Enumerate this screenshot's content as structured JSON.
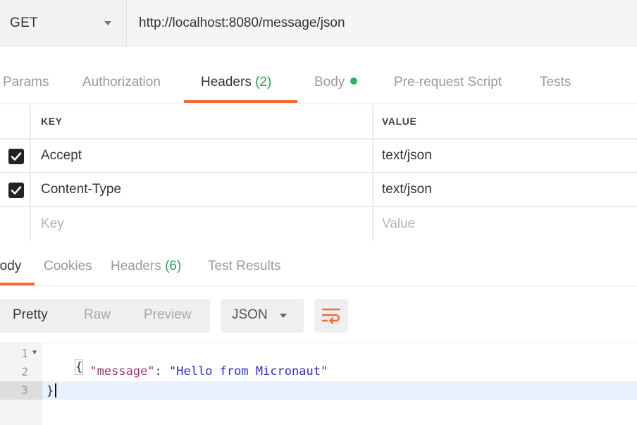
{
  "request": {
    "method": "GET",
    "url": "http://localhost:8080/message/json"
  },
  "request_tabs": {
    "params": "Params",
    "authorization": "Authorization",
    "headers": "Headers",
    "headers_count": "(2)",
    "body": "Body",
    "prerequest": "Pre-request Script",
    "tests": "Tests"
  },
  "headers_table": {
    "col_key": "KEY",
    "col_value": "VALUE",
    "rows": [
      {
        "checked": true,
        "key": "Accept",
        "value": "text/json"
      },
      {
        "checked": true,
        "key": "Content-Type",
        "value": "text/json"
      }
    ],
    "placeholder_key": "Key",
    "placeholder_value": "Value"
  },
  "response_tabs": {
    "body": "Body",
    "cookies": "Cookies",
    "headers": "Headers",
    "headers_count": "(6)",
    "test_results": "Test Results"
  },
  "view": {
    "pretty": "Pretty",
    "raw": "Raw",
    "preview": "Preview",
    "format": "JSON",
    "wrap_icon": "wrap-lines-icon"
  },
  "code": {
    "line_numbers": [
      "1",
      "2",
      "3"
    ],
    "open_brace": "{",
    "key": "\"message\"",
    "colon": ": ",
    "value": "\"Hello from Micronaut\"",
    "close_brace": "}"
  },
  "colors": {
    "accent": "#f26b3a",
    "green": "#27a35a",
    "json_key": "#a0306a",
    "json_string": "#2a2ad0"
  }
}
